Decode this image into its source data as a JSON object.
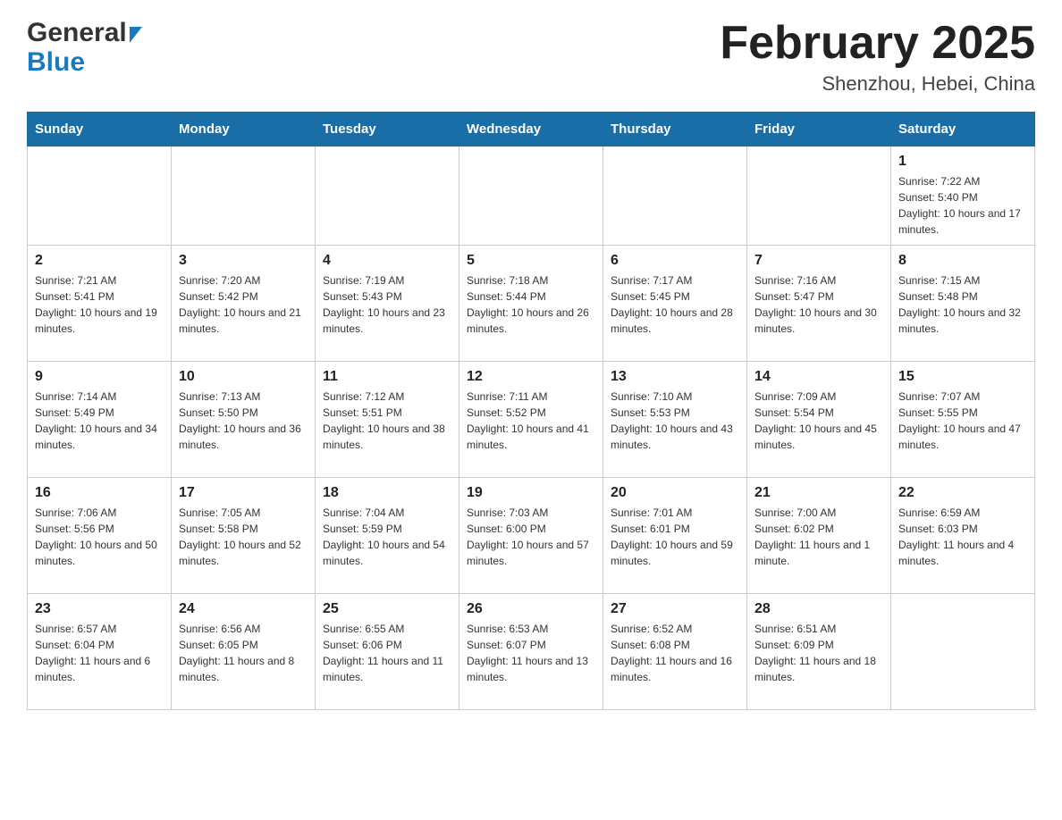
{
  "header": {
    "logo_general": "General",
    "logo_blue": "Blue",
    "title": "February 2025",
    "subtitle": "Shenzhou, Hebei, China"
  },
  "days_of_week": [
    "Sunday",
    "Monday",
    "Tuesday",
    "Wednesday",
    "Thursday",
    "Friday",
    "Saturday"
  ],
  "weeks": [
    [
      {
        "day": "",
        "sunrise": "",
        "sunset": "",
        "daylight": ""
      },
      {
        "day": "",
        "sunrise": "",
        "sunset": "",
        "daylight": ""
      },
      {
        "day": "",
        "sunrise": "",
        "sunset": "",
        "daylight": ""
      },
      {
        "day": "",
        "sunrise": "",
        "sunset": "",
        "daylight": ""
      },
      {
        "day": "",
        "sunrise": "",
        "sunset": "",
        "daylight": ""
      },
      {
        "day": "",
        "sunrise": "",
        "sunset": "",
        "daylight": ""
      },
      {
        "day": "1",
        "sunrise": "Sunrise: 7:22 AM",
        "sunset": "Sunset: 5:40 PM",
        "daylight": "Daylight: 10 hours and 17 minutes."
      }
    ],
    [
      {
        "day": "2",
        "sunrise": "Sunrise: 7:21 AM",
        "sunset": "Sunset: 5:41 PM",
        "daylight": "Daylight: 10 hours and 19 minutes."
      },
      {
        "day": "3",
        "sunrise": "Sunrise: 7:20 AM",
        "sunset": "Sunset: 5:42 PM",
        "daylight": "Daylight: 10 hours and 21 minutes."
      },
      {
        "day": "4",
        "sunrise": "Sunrise: 7:19 AM",
        "sunset": "Sunset: 5:43 PM",
        "daylight": "Daylight: 10 hours and 23 minutes."
      },
      {
        "day": "5",
        "sunrise": "Sunrise: 7:18 AM",
        "sunset": "Sunset: 5:44 PM",
        "daylight": "Daylight: 10 hours and 26 minutes."
      },
      {
        "day": "6",
        "sunrise": "Sunrise: 7:17 AM",
        "sunset": "Sunset: 5:45 PM",
        "daylight": "Daylight: 10 hours and 28 minutes."
      },
      {
        "day": "7",
        "sunrise": "Sunrise: 7:16 AM",
        "sunset": "Sunset: 5:47 PM",
        "daylight": "Daylight: 10 hours and 30 minutes."
      },
      {
        "day": "8",
        "sunrise": "Sunrise: 7:15 AM",
        "sunset": "Sunset: 5:48 PM",
        "daylight": "Daylight: 10 hours and 32 minutes."
      }
    ],
    [
      {
        "day": "9",
        "sunrise": "Sunrise: 7:14 AM",
        "sunset": "Sunset: 5:49 PM",
        "daylight": "Daylight: 10 hours and 34 minutes."
      },
      {
        "day": "10",
        "sunrise": "Sunrise: 7:13 AM",
        "sunset": "Sunset: 5:50 PM",
        "daylight": "Daylight: 10 hours and 36 minutes."
      },
      {
        "day": "11",
        "sunrise": "Sunrise: 7:12 AM",
        "sunset": "Sunset: 5:51 PM",
        "daylight": "Daylight: 10 hours and 38 minutes."
      },
      {
        "day": "12",
        "sunrise": "Sunrise: 7:11 AM",
        "sunset": "Sunset: 5:52 PM",
        "daylight": "Daylight: 10 hours and 41 minutes."
      },
      {
        "day": "13",
        "sunrise": "Sunrise: 7:10 AM",
        "sunset": "Sunset: 5:53 PM",
        "daylight": "Daylight: 10 hours and 43 minutes."
      },
      {
        "day": "14",
        "sunrise": "Sunrise: 7:09 AM",
        "sunset": "Sunset: 5:54 PM",
        "daylight": "Daylight: 10 hours and 45 minutes."
      },
      {
        "day": "15",
        "sunrise": "Sunrise: 7:07 AM",
        "sunset": "Sunset: 5:55 PM",
        "daylight": "Daylight: 10 hours and 47 minutes."
      }
    ],
    [
      {
        "day": "16",
        "sunrise": "Sunrise: 7:06 AM",
        "sunset": "Sunset: 5:56 PM",
        "daylight": "Daylight: 10 hours and 50 minutes."
      },
      {
        "day": "17",
        "sunrise": "Sunrise: 7:05 AM",
        "sunset": "Sunset: 5:58 PM",
        "daylight": "Daylight: 10 hours and 52 minutes."
      },
      {
        "day": "18",
        "sunrise": "Sunrise: 7:04 AM",
        "sunset": "Sunset: 5:59 PM",
        "daylight": "Daylight: 10 hours and 54 minutes."
      },
      {
        "day": "19",
        "sunrise": "Sunrise: 7:03 AM",
        "sunset": "Sunset: 6:00 PM",
        "daylight": "Daylight: 10 hours and 57 minutes."
      },
      {
        "day": "20",
        "sunrise": "Sunrise: 7:01 AM",
        "sunset": "Sunset: 6:01 PM",
        "daylight": "Daylight: 10 hours and 59 minutes."
      },
      {
        "day": "21",
        "sunrise": "Sunrise: 7:00 AM",
        "sunset": "Sunset: 6:02 PM",
        "daylight": "Daylight: 11 hours and 1 minute."
      },
      {
        "day": "22",
        "sunrise": "Sunrise: 6:59 AM",
        "sunset": "Sunset: 6:03 PM",
        "daylight": "Daylight: 11 hours and 4 minutes."
      }
    ],
    [
      {
        "day": "23",
        "sunrise": "Sunrise: 6:57 AM",
        "sunset": "Sunset: 6:04 PM",
        "daylight": "Daylight: 11 hours and 6 minutes."
      },
      {
        "day": "24",
        "sunrise": "Sunrise: 6:56 AM",
        "sunset": "Sunset: 6:05 PM",
        "daylight": "Daylight: 11 hours and 8 minutes."
      },
      {
        "day": "25",
        "sunrise": "Sunrise: 6:55 AM",
        "sunset": "Sunset: 6:06 PM",
        "daylight": "Daylight: 11 hours and 11 minutes."
      },
      {
        "day": "26",
        "sunrise": "Sunrise: 6:53 AM",
        "sunset": "Sunset: 6:07 PM",
        "daylight": "Daylight: 11 hours and 13 minutes."
      },
      {
        "day": "27",
        "sunrise": "Sunrise: 6:52 AM",
        "sunset": "Sunset: 6:08 PM",
        "daylight": "Daylight: 11 hours and 16 minutes."
      },
      {
        "day": "28",
        "sunrise": "Sunrise: 6:51 AM",
        "sunset": "Sunset: 6:09 PM",
        "daylight": "Daylight: 11 hours and 18 minutes."
      },
      {
        "day": "",
        "sunrise": "",
        "sunset": "",
        "daylight": ""
      }
    ]
  ]
}
